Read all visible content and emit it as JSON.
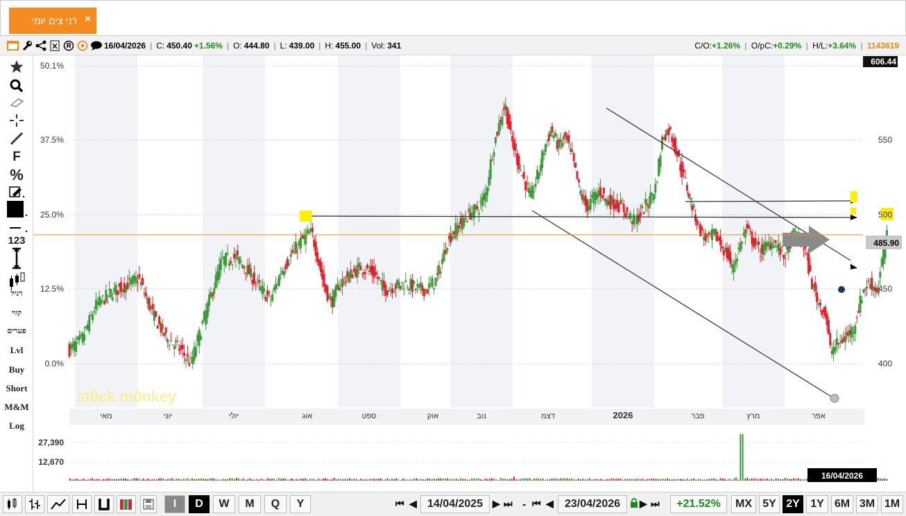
{
  "tab": {
    "label": "רני צים יומי",
    "close": "×"
  },
  "info": {
    "date": "16/04/2026",
    "close_label": "C:",
    "close_value": "450.40",
    "close_change": "+1.56%",
    "open_label": "O:",
    "open_value": "444.80",
    "low_label": "L:",
    "low_value": "439.00",
    "high_label": "H:",
    "high_value": "455.00",
    "vol_label": "Vol:",
    "vol_value": "341",
    "co_label": "C/O:",
    "co_value": "+1.26%",
    "opc_label": "O/pC:",
    "opc_value": "+0.29%",
    "hl_label": "H/L:",
    "hl_value": "+3.64%",
    "id": "1143619"
  },
  "leftbar": {
    "f_label": "F",
    "percent_label": "%",
    "num_label": "123",
    "candle_label": "רגיל",
    "lineb_label": "קווי",
    "bars_label": "פערים",
    "lvl": "Lvl",
    "buy": "Buy",
    "short": "Short",
    "mm": "M&M",
    "log": "Log"
  },
  "colors": {
    "up": "#3a9a3a",
    "down": "#e0202a",
    "accent": "#f58a1f",
    "lastline": "#e8892a",
    "highlight": "#ffee00"
  },
  "chart_data": {
    "type": "candlestick",
    "months": [
      "מאי",
      "יוני",
      "יולי",
      "אוג",
      "ספט",
      "אוק",
      "נוב",
      "דצמ",
      "2026",
      "פבר",
      "מרץ",
      "אפר"
    ],
    "pct_ticks": [
      "50.1%",
      "37.5%",
      "25.0%",
      "12.5%",
      "0.0%"
    ],
    "price_ticks": [
      "550",
      "500",
      "450",
      "400"
    ],
    "price_max": "606.44",
    "last_price": "485.90",
    "last_price_value": 485.9,
    "volume_ticks": [
      "27,390",
      "12,670"
    ],
    "date_label": "16/04/2026",
    "ylim": [
      378,
      606.44
    ],
    "price_points": [
      [
        0,
        405
      ],
      [
        18,
        412
      ],
      [
        38,
        436
      ],
      [
        60,
        445
      ],
      [
        80,
        450
      ],
      [
        100,
        455
      ],
      [
        120,
        430
      ],
      [
        140,
        413
      ],
      [
        160,
        405
      ],
      [
        175,
        395
      ],
      [
        190,
        420
      ],
      [
        205,
        445
      ],
      [
        220,
        468
      ],
      [
        240,
        470
      ],
      [
        255,
        462
      ],
      [
        275,
        448
      ],
      [
        290,
        440
      ],
      [
        305,
        460
      ],
      [
        320,
        472
      ],
      [
        335,
        482
      ],
      [
        345,
        487
      ],
      [
        350,
        486
      ],
      [
        358,
        470
      ],
      [
        368,
        448
      ],
      [
        378,
        438
      ],
      [
        390,
        452
      ],
      [
        405,
        458
      ],
      [
        420,
        463
      ],
      [
        440,
        458
      ],
      [
        455,
        447
      ],
      [
        470,
        450
      ],
      [
        485,
        452
      ],
      [
        500,
        448
      ],
      [
        515,
        447
      ],
      [
        530,
        455
      ],
      [
        545,
        482
      ],
      [
        560,
        492
      ],
      [
        575,
        500
      ],
      [
        590,
        505
      ],
      [
        600,
        515
      ],
      [
        610,
        545
      ],
      [
        620,
        565
      ],
      [
        628,
        578
      ],
      [
        636,
        555
      ],
      [
        645,
        540
      ],
      [
        655,
        525
      ],
      [
        665,
        512
      ],
      [
        675,
        528
      ],
      [
        685,
        548
      ],
      [
        695,
        560
      ],
      [
        705,
        548
      ],
      [
        715,
        555
      ],
      [
        725,
        540
      ],
      [
        735,
        518
      ],
      [
        745,
        505
      ],
      [
        755,
        512
      ],
      [
        765,
        517
      ],
      [
        775,
        510
      ],
      [
        785,
        508
      ],
      [
        795,
        506
      ],
      [
        805,
        500
      ],
      [
        815,
        495
      ],
      [
        825,
        502
      ],
      [
        835,
        510
      ],
      [
        845,
        520
      ],
      [
        855,
        555
      ],
      [
        865,
        560
      ],
      [
        875,
        545
      ],
      [
        880,
        535
      ],
      [
        890,
        520
      ],
      [
        895,
        510
      ],
      [
        905,
        495
      ],
      [
        912,
        486
      ],
      [
        920,
        482
      ],
      [
        930,
        487
      ],
      [
        940,
        478
      ],
      [
        950,
        470
      ],
      [
        955,
        462
      ],
      [
        965,
        476
      ],
      [
        975,
        490
      ],
      [
        985,
        482
      ],
      [
        995,
        474
      ],
      [
        1005,
        478
      ],
      [
        1015,
        482
      ],
      [
        1030,
        470
      ],
      [
        1045,
        488
      ],
      [
        1060,
        476
      ],
      [
        1070,
        452
      ],
      [
        1080,
        438
      ],
      [
        1090,
        430
      ],
      [
        1097,
        404
      ],
      [
        1105,
        408
      ],
      [
        1115,
        412
      ],
      [
        1130,
        420
      ],
      [
        1145,
        448
      ],
      [
        1155,
        452
      ],
      [
        1165,
        446
      ],
      [
        1172,
        470
      ],
      [
        1180,
        488
      ]
    ],
    "volumes": [
      [
        8,
        2
      ],
      [
        20,
        2
      ],
      [
        40,
        3
      ],
      [
        60,
        2
      ],
      [
        80,
        4
      ],
      [
        100,
        3
      ],
      [
        120,
        2
      ],
      [
        140,
        3
      ],
      [
        160,
        2
      ],
      [
        180,
        3
      ],
      [
        200,
        2
      ],
      [
        220,
        3
      ],
      [
        240,
        5
      ],
      [
        260,
        3
      ],
      [
        280,
        2
      ],
      [
        300,
        5
      ],
      [
        320,
        4
      ],
      [
        340,
        3
      ],
      [
        360,
        2
      ],
      [
        380,
        5
      ],
      [
        400,
        3
      ],
      [
        420,
        2
      ],
      [
        440,
        3
      ],
      [
        460,
        2
      ],
      [
        480,
        4
      ],
      [
        500,
        3
      ],
      [
        520,
        2
      ],
      [
        540,
        3
      ],
      [
        560,
        2
      ],
      [
        580,
        4
      ],
      [
        600,
        3
      ],
      [
        620,
        5
      ],
      [
        640,
        7
      ],
      [
        660,
        4
      ],
      [
        680,
        3
      ],
      [
        700,
        4
      ],
      [
        720,
        3
      ],
      [
        740,
        3
      ],
      [
        760,
        2
      ],
      [
        780,
        4
      ],
      [
        800,
        3
      ],
      [
        820,
        2
      ],
      [
        840,
        3
      ],
      [
        860,
        5
      ],
      [
        880,
        3
      ],
      [
        900,
        4
      ],
      [
        920,
        3
      ],
      [
        940,
        4
      ],
      [
        960,
        6
      ],
      [
        968,
        82
      ],
      [
        975,
        5
      ],
      [
        990,
        4
      ],
      [
        1010,
        3
      ],
      [
        1030,
        5
      ],
      [
        1050,
        4
      ],
      [
        1070,
        3
      ],
      [
        1090,
        4
      ],
      [
        1110,
        2
      ],
      [
        1130,
        3
      ]
    ]
  },
  "bottom": {
    "b1": "I",
    "b2": "D",
    "b3": "W",
    "b4": "M",
    "b5": "Q",
    "b6": "Y",
    "from_date": "14/04/2025",
    "dash": "-",
    "to_date": "23/04/2026",
    "change": "+21.52%",
    "r1": "MX",
    "r2": "5Y",
    "r3": "2Y",
    "r4": "1Y",
    "r5": "6M",
    "r6": "3M",
    "r7": "1M"
  }
}
